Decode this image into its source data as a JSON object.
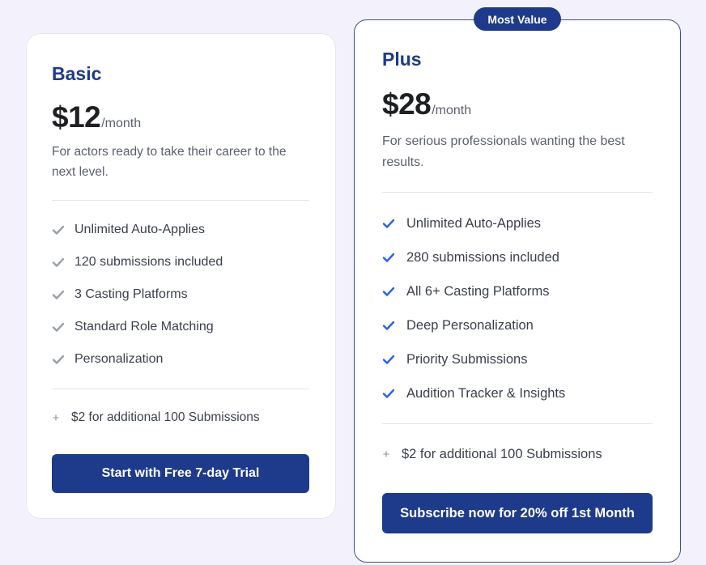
{
  "badge": {
    "label": "Most Value"
  },
  "plans": {
    "basic": {
      "name": "Basic",
      "price": "$12",
      "period": "/month",
      "description_line1": "For actors ready to take their career to the",
      "description_line2": "next level.",
      "features": [
        "Unlimited Auto-Applies",
        "120 submissions included",
        "3 Casting Platforms",
        "Standard Role Matching",
        "Personalization"
      ],
      "check_color": "#9aa0a8",
      "addon_symbol": "+",
      "addon": "$2 for additional 100 Submissions",
      "cta": "Start with Free 7-day Trial"
    },
    "plus": {
      "name": "Plus",
      "price": "$28",
      "period": "/month",
      "description_line1": "For serious professionals wanting the best",
      "description_line2": "results.",
      "features": [
        "Unlimited Auto-Applies",
        "280 submissions included",
        "All 6+ Casting Platforms",
        "Deep Personalization",
        "Priority Submissions",
        "Audition Tracker & Insights"
      ],
      "check_color": "#2563eb",
      "addon_symbol": "+",
      "addon": "$2 for additional 100 Submissions",
      "cta": "Subscribe now for 20% off 1st Month"
    }
  },
  "colors": {
    "accent": "#1e3a8a",
    "background": "#f3f2fc",
    "card": "#ffffff"
  }
}
